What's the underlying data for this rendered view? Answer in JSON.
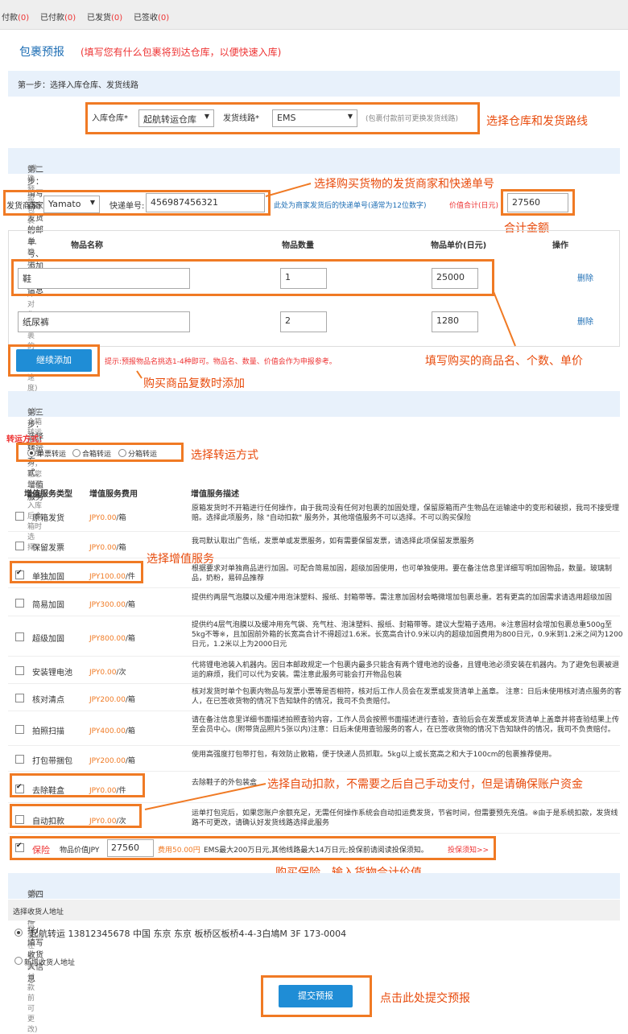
{
  "topbar": {
    "tabs": [
      {
        "label": "付款",
        "count": "(0)"
      },
      {
        "label": "已付款",
        "count": "(0)"
      },
      {
        "label": "已发货",
        "count": "(0)"
      },
      {
        "label": "已签收",
        "count": "(0)"
      }
    ]
  },
  "header": {
    "title": "包裹预报",
    "hint": "(填写您有什么包裹将到达仓库，以便快速入库)"
  },
  "step1": {
    "title": "第一步：选择入库仓库、发货线路",
    "warehouse_label": "入库仓库*",
    "warehouse_value": "起航转运仓库",
    "route_label": "发货线路*",
    "route_value": "EMS",
    "note": "(包裹付款前可更换发货线路)",
    "annotation": "选择仓库和发货路线"
  },
  "step2": {
    "title": "第二步：填写商家发货的邮单号、添加物品信息",
    "subtitle": "(准确预报包裹信息,能加快仓库对您包裹的处理速度)",
    "annotation_top": "选择购买货物的发货商家和快递单号",
    "merchant_label": "发货商家:",
    "merchant_value": "Yamato",
    "tracking_label": "快递单号:",
    "tracking_value": "456987456321",
    "tracking_note": "此处为商家发货后的快递单号(通常为12位数字)",
    "total_label": "价值合计(日元)",
    "total_value": "27560",
    "annotation_total": "合计金额",
    "columns": [
      "物品名称",
      "物品数量",
      "物品单价(日元)",
      "操作"
    ],
    "items": [
      {
        "name": "鞋",
        "qty": "1",
        "price": "25000",
        "action": "删除"
      },
      {
        "name": "纸尿裤",
        "qty": "2",
        "price": "1280",
        "action": "删除"
      }
    ],
    "add_button": "继续添加",
    "add_hint": "提示:预报物品名挑选1-4种即可。物品名、数量、价值会作为申报参考。",
    "annotation_items": "填写购买的商品名、个数、单价",
    "annotation_add": "购买商品复数时添加"
  },
  "step3": {
    "title": "第三步：选择转运方式、增值服务",
    "subtitle": "(分/合箱转运的增值服务，在您包裹全部入库后合箱时选择)",
    "method_label": "转运方式：",
    "methods": [
      "单票转运",
      "合箱转运",
      "分箱转运"
    ],
    "annotation_method": "选择转运方式",
    "columns": [
      "增值服务类型",
      "增值服务费用",
      "增值服务描述"
    ],
    "services": [
      {
        "name": "原箱发货",
        "fee": "JPY0.00",
        "unit": "/箱",
        "checked": false,
        "desc": "原箱发货时不开箱进行任何操作，由于我司没有任何对包裹的加固处理，保留原箱而产生物品在运输途中的变形和破损，我司不接受理赔。选择此项服务，除 \"自动扣款\" 服务外，其他增值服务不可以选择。不可以购买保险"
      },
      {
        "name": "保留发票",
        "fee": "JPY0.00",
        "unit": "/箱",
        "checked": false,
        "desc": "我司默认取出广告纸，发票单或发票服务，如有需要保留发票，请选择此项保留发票服务"
      },
      {
        "name": "单独加固",
        "fee": "JPY100.00",
        "unit": "/件",
        "checked": true,
        "desc": "根据要求对单独商品进行加固。可配合简易加固，超级加固使用，也可单独使用。要在备注信息里详细写明加固物品，数量。玻璃制品，奶粉，易碎品推荐"
      },
      {
        "name": "简易加固",
        "fee": "JPY300.00",
        "unit": "/箱",
        "checked": false,
        "desc": "提供约两层气泡膜以及缓冲用泡沫塑料、报纸、封箱带等。需注意加固材会略微增加包裹总重。若有更高的加固需求请选用超级加固"
      },
      {
        "name": "超级加固",
        "fee": "JPY800.00",
        "unit": "/箱",
        "checked": false,
        "desc": "提供约4层气泡膜以及缓冲用充气袋、充气柱、泡沫塑料、报纸、封箱带等。建议大型箱子选用。※注意固材会增加包裹总重500g至5kg不等※，且加固前外箱的长宽高合计不得超过1.6米。长宽高合计0.9米以内的超级加固费用为800日元，0.9米到1.2米之间为1200日元，1.2米以上为2000日元"
      },
      {
        "name": "安装锂电池",
        "fee": "JPY0.00",
        "unit": "/次",
        "checked": false,
        "desc": "代将锂电池装入机器内。因日本邮政规定一个包裹内最多只能含有两个锂电池的设备，且锂电池必须安装在机器内。为了避免包裹被退运的麻烦，我们可以代为安装。需注意此服务可能会打开物品包装"
      },
      {
        "name": "核对清点",
        "fee": "JPY200.00",
        "unit": "/箱",
        "checked": false,
        "desc": "核对发货时单个包裹内物品与发票小票等是否相符，核对后工作人员会在发票或发货清单上盖章。 注意：日后未使用核对清点服务的客人，在已签收货物的情况下告知缺件的情况，我司不负责赔付。"
      },
      {
        "name": "拍照扫描",
        "fee": "JPY400.00",
        "unit": "/箱",
        "checked": false,
        "desc": "请在备注信息里详细书面描述拍照查验内容，工作人员会按照书面描述进行查验，查验后会在发票或发货清单上盖章并将查验结果上传至会员中心。(附带货品照片5张以内)注意：日后未使用查验服务的客人，在已签收货物的情况下告知缺件的情况，我司不负责赔付。"
      },
      {
        "name": "打包带捆包",
        "fee": "JPY200.00",
        "unit": "/箱",
        "checked": false,
        "desc": "使用高强度打包带打包，有效防止散箱，便于快递人员抓取。5kg以上或长宽高之和大于100cm的包裹推荐使用。"
      },
      {
        "name": "去除鞋盒",
        "fee": "JPY0.00",
        "unit": "/件",
        "checked": true,
        "desc": "去除鞋子的外包装盒"
      },
      {
        "name": "自动扣款",
        "fee": "JPY0.00",
        "unit": "/次",
        "checked": false,
        "desc": "运单打包完后，如果您账户余额充足，无需任何操作系统会自动扣运费发货，节省时间，但需要预先充值。※由于是系统扣款，发货线路不可更改，请确认好发货线路选择此服务"
      }
    ],
    "annotation_service": "选择增值服务",
    "annotation_auto": "选择自动扣款，不需要之后自己手动支付，但是请确保账户资金",
    "insurance": {
      "label": "保险",
      "value_label": "物品价值JPY",
      "value": "27560",
      "fee": "费用50.00円",
      "desc": "EMS最大200万日元,其他线路最大14万日元;投保前请阅读投保须知。",
      "link": "投保须知>>",
      "annotation": "购买保险，输入货物合计价值"
    }
  },
  "step4": {
    "title": "第四步：选择/填写收货人信息",
    "subtitle": "(收货人信息在包裹付款前可更改)",
    "select_label": "选择收货人地址",
    "address": "起航转运 13812345678 中国 东京 东京 板桥区板桥4-4-3白鳩M 3F 173-0004",
    "new_address": "新增收货人地址"
  },
  "submit": {
    "label": "提交预报",
    "annotation": "点击此处提交预报"
  },
  "colors": {
    "accent": "#f07a24",
    "link_blue": "#1f8dd6",
    "red": "#e33333",
    "section_bg": "#e8f1fb"
  }
}
